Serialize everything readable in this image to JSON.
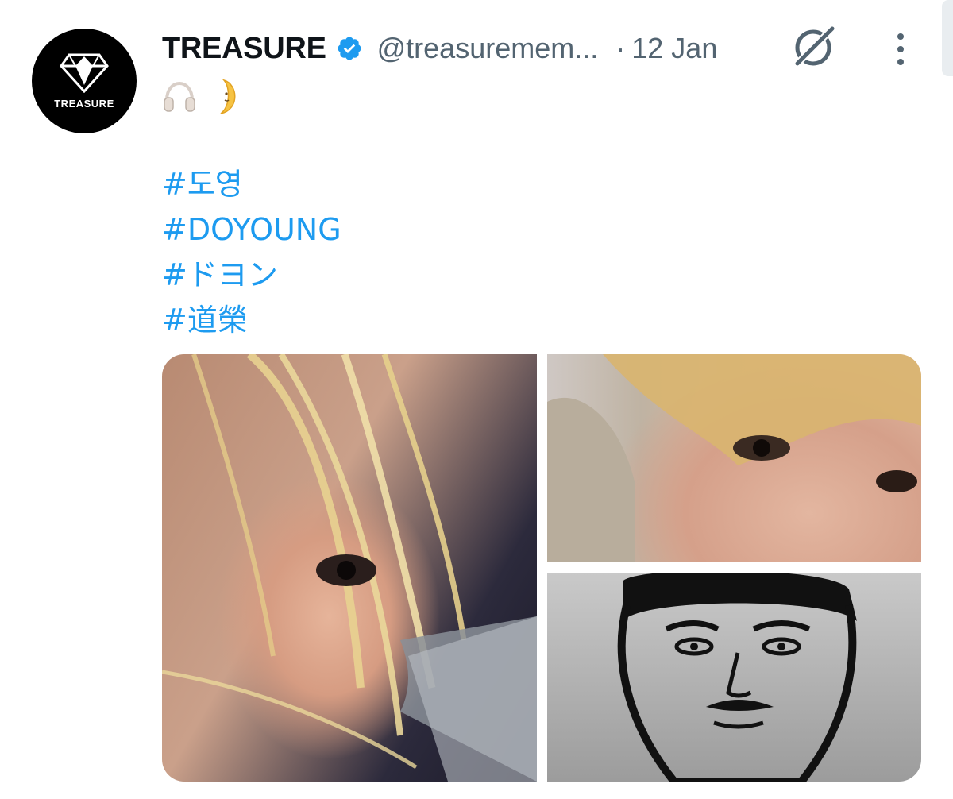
{
  "tweet": {
    "author": {
      "display_name": "TREASURE",
      "handle": "@treasuremem...",
      "avatar_text": "TREASURE",
      "verified": true
    },
    "separator": "·",
    "timestamp": "12 Jan",
    "emojis": [
      "headphone-emoji",
      "crescent-moon-emoji"
    ],
    "hashtags": [
      "#도영",
      "#DOYOUNG",
      "#ドヨン",
      "#道榮"
    ],
    "media": [
      {
        "kind": "photo",
        "subject": "selfie-close-up"
      },
      {
        "kind": "photo",
        "subject": "selfie-eyes"
      },
      {
        "kind": "photo",
        "subject": "ink-sketch-portrait"
      }
    ]
  },
  "icons": {
    "verified": "verified-badge-icon",
    "grok": "grok-icon",
    "more": "more-vertical-icon"
  },
  "colors": {
    "link": "#1d9bf0",
    "secondary_text": "#536471",
    "primary_text": "#0f1419",
    "verified_badge": "#1d9bf0"
  }
}
